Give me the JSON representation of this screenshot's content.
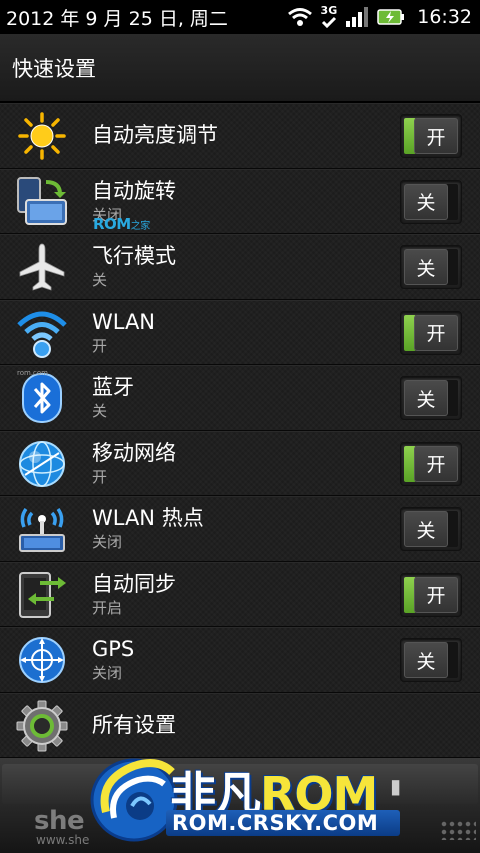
{
  "status_bar": {
    "date": "2012 年 9 月 25 日, 周二",
    "network_type": "3G",
    "time": "16:32"
  },
  "header": {
    "title": "快速设置"
  },
  "colors": {
    "toggle_on": "#6dbb36",
    "rom_blue": "#29a9e0",
    "logo_yellow": "#f6e53a"
  },
  "rows": [
    {
      "icon": "brightness-icon",
      "title": "自动亮度调节",
      "subtitle": "",
      "state": "on",
      "toggle_label": "开"
    },
    {
      "icon": "rotate-screen-icon",
      "title": "自动旋转",
      "subtitle": "关闭",
      "state": "off",
      "toggle_label": "关"
    },
    {
      "icon": "airplane-icon",
      "title": "飞行模式",
      "subtitle": "关",
      "state": "off",
      "toggle_label": "关"
    },
    {
      "icon": "wifi-icon",
      "title": "WLAN",
      "subtitle": "开",
      "state": "on",
      "toggle_label": "开"
    },
    {
      "icon": "bluetooth-icon",
      "title": "蓝牙",
      "subtitle": "关",
      "state": "off",
      "toggle_label": "关"
    },
    {
      "icon": "mobile-network-icon",
      "title": "移动网络",
      "subtitle": "开",
      "state": "on",
      "toggle_label": "开"
    },
    {
      "icon": "hotspot-icon",
      "title": "WLAN 热点",
      "subtitle": "关闭",
      "state": "off",
      "toggle_label": "关"
    },
    {
      "icon": "sync-icon",
      "title": "自动同步",
      "subtitle": "开启",
      "state": "on",
      "toggle_label": "开"
    },
    {
      "icon": "gps-icon",
      "title": "GPS",
      "subtitle": "关闭",
      "state": "off",
      "toggle_label": "关"
    },
    {
      "icon": "settings-gear-icon",
      "title": "所有设置",
      "subtitle": "",
      "state": "none",
      "toggle_label": ""
    }
  ],
  "watermarks": {
    "rom_home": "ROM",
    "rom_home_suffix": "之家",
    "tiny_url": "rom.com",
    "she": "she",
    "she_url": "www.she",
    "logo_cn": "非凡",
    "logo_rom": "ROM",
    "logo_url": "ROM.CRSKY.COM"
  }
}
